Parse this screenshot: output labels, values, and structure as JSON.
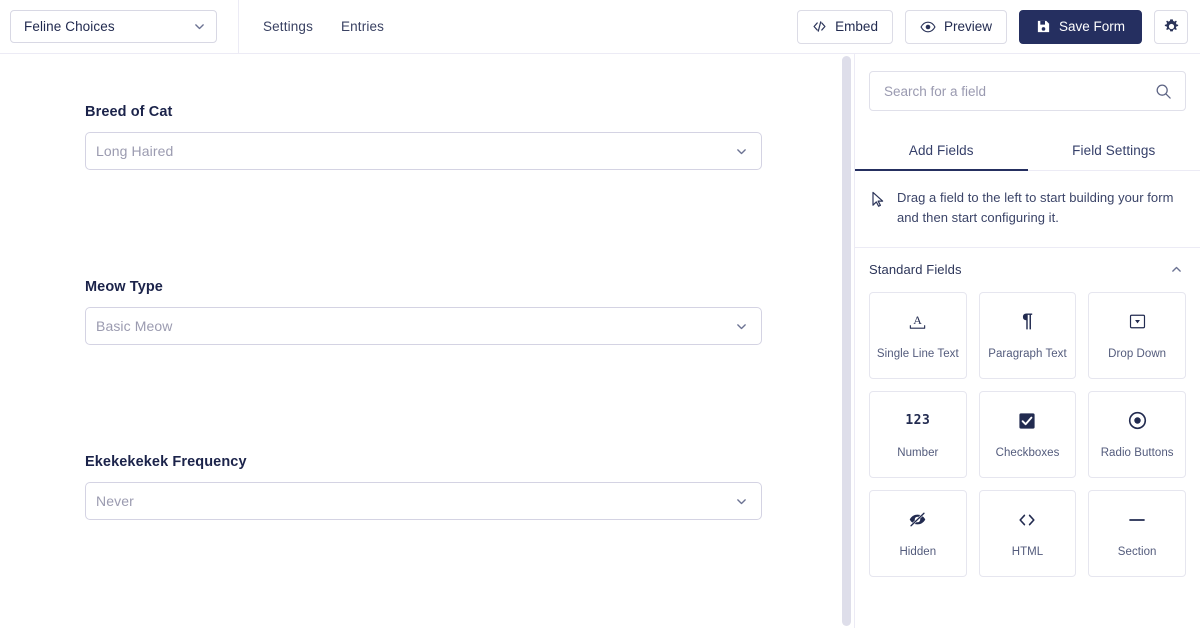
{
  "toolbar": {
    "form_switcher": {
      "value": "Feline Choices",
      "icon": "chevron-down-icon"
    },
    "nav": [
      {
        "label": "Settings",
        "name": "settings"
      },
      {
        "label": "Entries",
        "name": "entries"
      }
    ],
    "buttons": [
      {
        "label": "Embed",
        "name": "embed",
        "icon": "code-icon",
        "style": "secondary"
      },
      {
        "label": "Preview",
        "name": "preview",
        "icon": "eye-icon",
        "style": "secondary"
      },
      {
        "label": "Save Form",
        "name": "save-form",
        "icon": "save-disk-icon",
        "style": "primary"
      }
    ],
    "settings_icon": "gear-icon"
  },
  "colors": {
    "primary": "#252f60",
    "border": "#ecebf5",
    "field_border": "#d4d3e3",
    "placeholder": "#9b9bb0",
    "scrollbar": "#dedeea"
  },
  "canvas": {
    "fields": [
      {
        "label": "Breed of Cat",
        "value": "Long Haired",
        "type": "select"
      },
      {
        "label": "Meow Type",
        "value": "Basic Meow",
        "type": "select"
      },
      {
        "label": "Ekekekekek Frequency",
        "value": "Never",
        "type": "select"
      }
    ]
  },
  "panel": {
    "search": {
      "placeholder": "Search for a field",
      "value": "",
      "icon": "search-icon"
    },
    "tabs": [
      {
        "label": "Add Fields",
        "active": true
      },
      {
        "label": "Field Settings",
        "active": false
      }
    ],
    "drag_hint": {
      "icon": "mouse-pointer-icon",
      "text": "Drag a field to the left to start building your form and then start configuring it."
    },
    "section": {
      "title": "Standard Fields",
      "collapse_icon": "chevron-up-icon",
      "expanded": true
    },
    "field_types": [
      {
        "label": "Single Line Text",
        "icon": "text-width-icon"
      },
      {
        "label": "Paragraph Text",
        "icon": "pilcrow-icon"
      },
      {
        "label": "Drop Down",
        "icon": "dropdown-box-icon"
      },
      {
        "label": "Number",
        "icon": "numbers-123-icon"
      },
      {
        "label": "Checkboxes",
        "icon": "checkbox-checked-icon"
      },
      {
        "label": "Radio Buttons",
        "icon": "radio-selected-icon"
      },
      {
        "label": "Hidden",
        "icon": "eye-slash-icon"
      },
      {
        "label": "HTML",
        "icon": "angle-brackets-icon"
      },
      {
        "label": "Section",
        "icon": "horizontal-line-icon"
      }
    ]
  }
}
